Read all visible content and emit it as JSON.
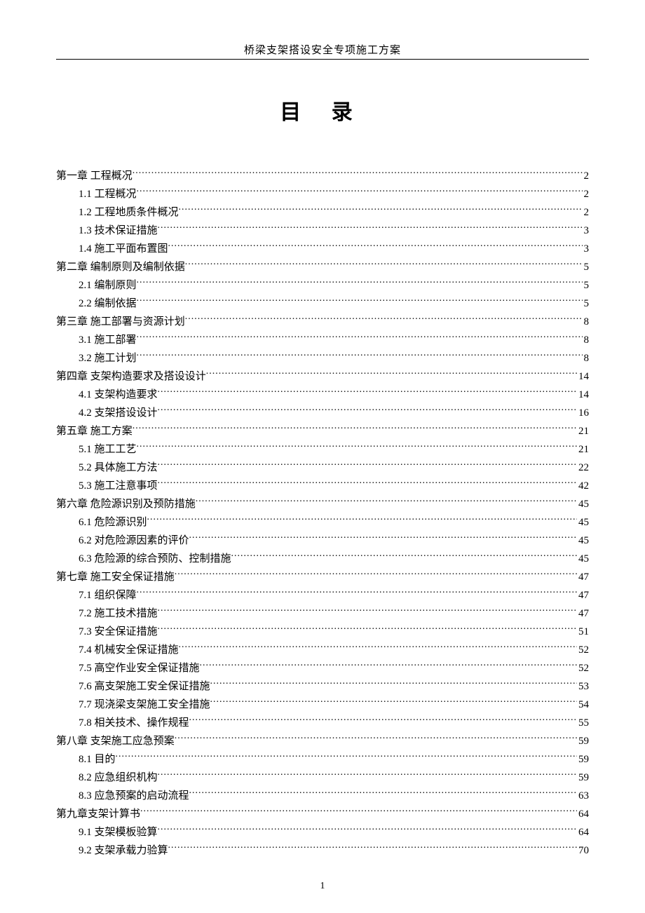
{
  "header": "桥梁支架搭设安全专项施工方案",
  "title": "目  录",
  "pageNumber": "1",
  "toc": [
    {
      "level": 0,
      "label": "第一章 工程概况",
      "page": "2"
    },
    {
      "level": 1,
      "label": "1.1 工程概况",
      "page": "2"
    },
    {
      "level": 1,
      "label": "1.2 工程地质条件概况",
      "page": "2"
    },
    {
      "level": 1,
      "label": "1.3 技术保证措施",
      "page": "3"
    },
    {
      "level": 1,
      "label": "1.4 施工平面布置图",
      "page": "3"
    },
    {
      "level": 0,
      "label": "第二章  编制原则及编制依据",
      "page": "5"
    },
    {
      "level": 1,
      "label": "2.1 编制原则",
      "page": "5"
    },
    {
      "level": 1,
      "label": "2.2 编制依据",
      "page": "5"
    },
    {
      "level": 0,
      "label": "第三章  施工部署与资源计划",
      "page": "8"
    },
    {
      "level": 1,
      "label": "3.1 施工部署",
      "page": "8"
    },
    {
      "level": 1,
      "label": "3.2  施工计划",
      "page": "8"
    },
    {
      "level": 0,
      "label": "第四章  支架构造要求及搭设设计 ",
      "page": "14"
    },
    {
      "level": 1,
      "label": "4.1 支架构造要求",
      "page": "14"
    },
    {
      "level": 1,
      "label": "4.2 支架搭设设计",
      "page": "16"
    },
    {
      "level": 0,
      "label": "第五章 施工方案",
      "page": "21"
    },
    {
      "level": 1,
      "label": "5.1 施工工艺",
      "page": "21"
    },
    {
      "level": 1,
      "label": "5.2 具体施工方法",
      "page": "22"
    },
    {
      "level": 1,
      "label": "5.3 施工注意事项",
      "page": "42"
    },
    {
      "level": 0,
      "label": "第六章  危险源识别及预防措施",
      "page": "45"
    },
    {
      "level": 1,
      "label": "6.1 危险源识别",
      "page": "45"
    },
    {
      "level": 1,
      "label": "6.2 对危险源因素的评价",
      "page": "45"
    },
    {
      "level": 1,
      "label": "6.3 危险源的综合预防、控制措施",
      "page": "45"
    },
    {
      "level": 0,
      "label": "第七章  施工安全保证措施",
      "page": "47"
    },
    {
      "level": 1,
      "label": "7.1 组织保障",
      "page": "47"
    },
    {
      "level": 1,
      "label": "7.2 施工技术措施",
      "page": "47"
    },
    {
      "level": 1,
      "label": "7.3 安全保证措施",
      "page": "51"
    },
    {
      "level": 1,
      "label": "7.4 机械安全保证措施",
      "page": "52"
    },
    {
      "level": 1,
      "label": "7.5 高空作业安全保证措施",
      "page": "52"
    },
    {
      "level": 1,
      "label": "7.6 高支架施工安全保证措施",
      "page": "53"
    },
    {
      "level": 1,
      "label": "7.7 现浇梁支架施工安全措施",
      "page": "54"
    },
    {
      "level": 1,
      "label": "7.8 相关技术、操作规程",
      "page": "55"
    },
    {
      "level": 0,
      "label": "第八章 支架施工应急预案",
      "page": "59"
    },
    {
      "level": 1,
      "label": "8.1 目的",
      "page": "59"
    },
    {
      "level": 1,
      "label": "8.2 应急组织机构",
      "page": "59"
    },
    {
      "level": 1,
      "label": "8.3 应急预案的启动流程",
      "page": "63"
    },
    {
      "level": 0,
      "label": "第九章支架计算书",
      "page": "64"
    },
    {
      "level": 1,
      "label": "9.1 支架模板验算",
      "page": "64"
    },
    {
      "level": 1,
      "label": "9.2 支架承载力验算",
      "page": "70"
    }
  ]
}
